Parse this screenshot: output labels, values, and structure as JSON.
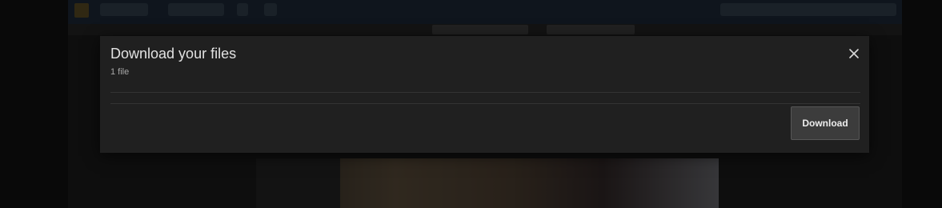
{
  "dialog": {
    "title": "Download your files",
    "subtitle": "1 file",
    "download_label": "Download",
    "close_icon": "close-icon"
  },
  "colors": {
    "dialog_bg": "#202020",
    "button_bg": "#3c3c3c",
    "overlay": "rgba(0,0,0,0.55)"
  }
}
